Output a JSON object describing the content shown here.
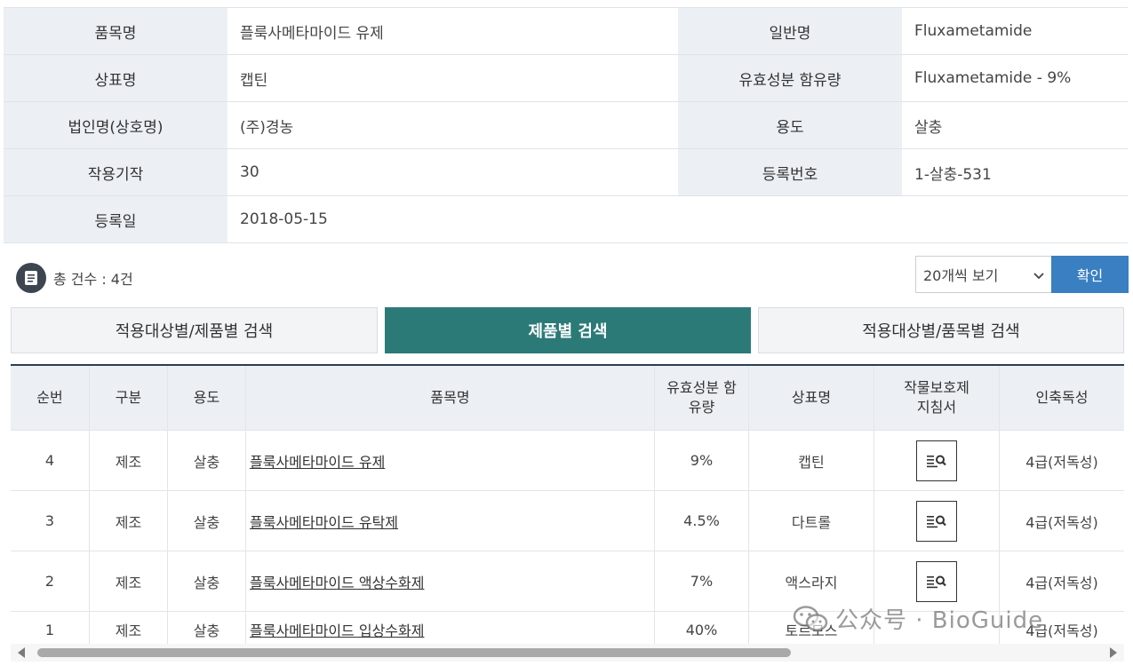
{
  "info": {
    "rows": [
      {
        "label1": "품목명",
        "value1": "플룩사메타마이드 유제",
        "label2": "일반명",
        "value2": "Fluxametamide"
      },
      {
        "label1": "상표명",
        "value1": "캡틴",
        "label2": "유효성분 함유량",
        "value2": "Fluxametamide - 9%"
      },
      {
        "label1": "법인명(상호명)",
        "value1": "(주)경농",
        "label2": "용도",
        "value2": "살충"
      },
      {
        "label1": "작용기작",
        "value1": "30",
        "label2": "등록번호",
        "value2": "1-살충-531"
      },
      {
        "label1": "등록일",
        "value1": "2018-05-15"
      }
    ]
  },
  "count": {
    "text": "총 건수 : 4건"
  },
  "paging": {
    "page_size": "20개씩 보기",
    "confirm": "확인"
  },
  "tabs": [
    {
      "label": "적용대상별/제품별 검색",
      "active": false
    },
    {
      "label": "제품별 검색",
      "active": true
    },
    {
      "label": "적용대상별/품목별 검색",
      "active": false
    }
  ],
  "table": {
    "headers": [
      "순번",
      "구분",
      "용도",
      "품목명",
      "유효성분 함유량",
      "상표명",
      "작물보호제 지침서",
      "인축독성"
    ],
    "rows": [
      {
        "no": "4",
        "type": "제조",
        "use": "살충",
        "name": "플룩사메타마이드 유제",
        "content": "9%",
        "brand": "캡틴",
        "toxicity": "4급(저독성)"
      },
      {
        "no": "3",
        "type": "제조",
        "use": "살충",
        "name": "플룩사메타마이드 유탁제",
        "content": "4.5%",
        "brand": "다트롤",
        "toxicity": "4급(저독성)"
      },
      {
        "no": "2",
        "type": "제조",
        "use": "살충",
        "name": "플룩사메타마이드 액상수화제",
        "content": "7%",
        "brand": "액스라지",
        "toxicity": "4급(저독성)"
      },
      {
        "no": "1",
        "type": "제조",
        "use": "살충",
        "name": "플룩사메타마이드 입상수화제",
        "content": "40%",
        "brand": "토르모스",
        "toxicity": "4급(저독성)"
      }
    ]
  },
  "watermark": {
    "text": "公众号 · BioGuide"
  },
  "colors": {
    "accent_tab": "#2b7a78",
    "confirm_button": "#3a7fc2",
    "label_bg": "#ecf0f4"
  }
}
